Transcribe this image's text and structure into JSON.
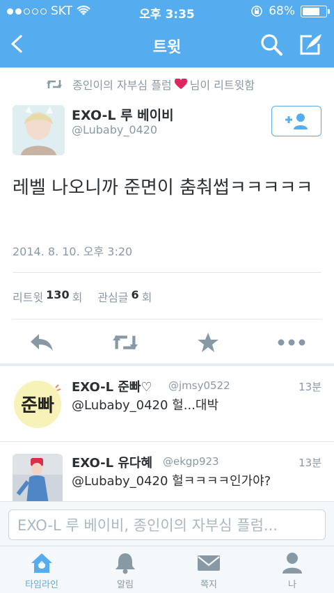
{
  "status_bar": {
    "carrier": "SKT",
    "time": "오후 3:35",
    "battery": "68%",
    "battery_level": 0.68
  },
  "nav": {
    "title": "트윗",
    "back_icon": "chevron-left-icon",
    "search_icon": "search-icon",
    "compose_icon": "compose-icon"
  },
  "retweet_line": {
    "text": "종인이의 자부심 플럼",
    "suffix": "님이 리트윗함",
    "icon": "retweet-icon"
  },
  "tweet": {
    "author_name": "EXO-L 루 베이비",
    "author_handle": "@Lubaby_0420",
    "text": "레벨 나오니까 준면이 춤춰썹ㅋㅋㅋㅋㅋ",
    "timestamp": "2014. 8. 10. 오후 3:20",
    "stats": {
      "retweet_label": "리트윗",
      "retweet_count": "130",
      "retweet_unit": "회",
      "like_label": "관심글",
      "like_count": "6",
      "like_unit": "회"
    }
  },
  "replies": [
    {
      "name": "EXO-L  준빠♡",
      "handle": "@jmsy0522",
      "time": "13분",
      "text": "@Lubaby_0420 헐...대박",
      "avatar_text": "준빠"
    },
    {
      "name": "EXO-L 유다혜",
      "handle": "@ekgp923",
      "time": "13분",
      "text": "@Lubaby_0420 헐ㅋㅋㅋㅋ인가야?"
    }
  ],
  "composer": {
    "placeholder": "EXO-L 루 베이비, 종인이의 자부심 플럼..."
  },
  "tabs": [
    {
      "label": "타임라인",
      "icon": "home-icon",
      "active": true
    },
    {
      "label": "알림",
      "icon": "bell-icon",
      "active": false
    },
    {
      "label": "쪽지",
      "icon": "envelope-icon",
      "active": false
    },
    {
      "label": "나",
      "icon": "person-icon",
      "active": false
    }
  ],
  "colors": {
    "brand": "#55acee",
    "text": "#292f33",
    "muted": "#8899a6",
    "heart": "#e0245e"
  }
}
